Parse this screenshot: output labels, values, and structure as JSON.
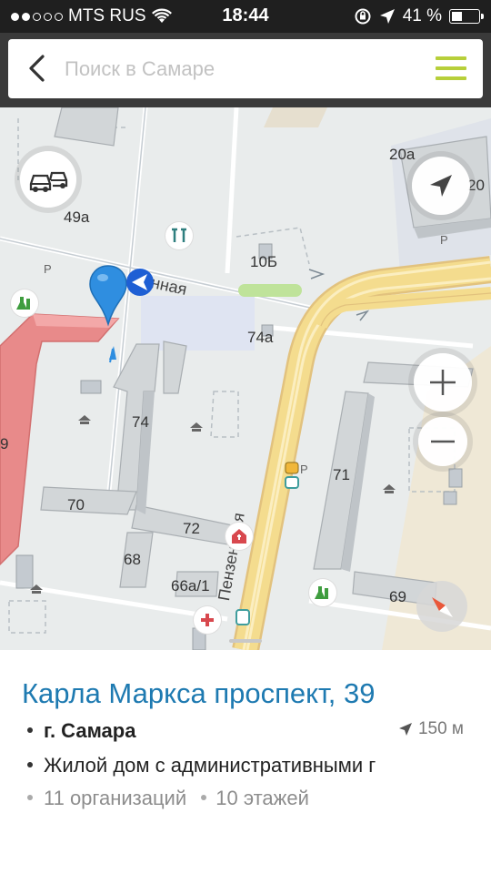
{
  "status_bar": {
    "carrier": "MTS RUS",
    "time": "18:44",
    "battery": "41 %",
    "battery_fraction": 0.41
  },
  "search": {
    "placeholder": "Поиск в Самаре",
    "value": ""
  },
  "map": {
    "building_labels": [
      "49а",
      "10Б",
      "74а",
      "74",
      "71",
      "70",
      "72",
      "68",
      "66а/1",
      "69",
      "20а",
      "20",
      "9"
    ],
    "street_labels": [
      "нная",
      "Пензенская"
    ],
    "parking_symbol": "P"
  },
  "place": {
    "title": "Карла Маркса проспект, 39",
    "city": "г. Самара",
    "distance": "150 м",
    "description": "Жилой дом с административными г",
    "organizations": "11 организаций",
    "floors": "10 этажей"
  },
  "colors": {
    "accent_green": "#b7cf3a",
    "title_blue": "#1e7ab1",
    "highlight_building": "#e88a8a",
    "road_yellow": "#f4dc8e",
    "pin_blue": "#2f8ee0"
  },
  "icons": [
    "back-arrow-icon",
    "hamburger-menu-icon",
    "traffic-cars-icon",
    "navigate-arrow-icon",
    "zoom-in-icon",
    "zoom-out-icon",
    "compass-icon",
    "location-pin-icon",
    "wifi-icon",
    "location-arrow-icon",
    "battery-icon"
  ]
}
